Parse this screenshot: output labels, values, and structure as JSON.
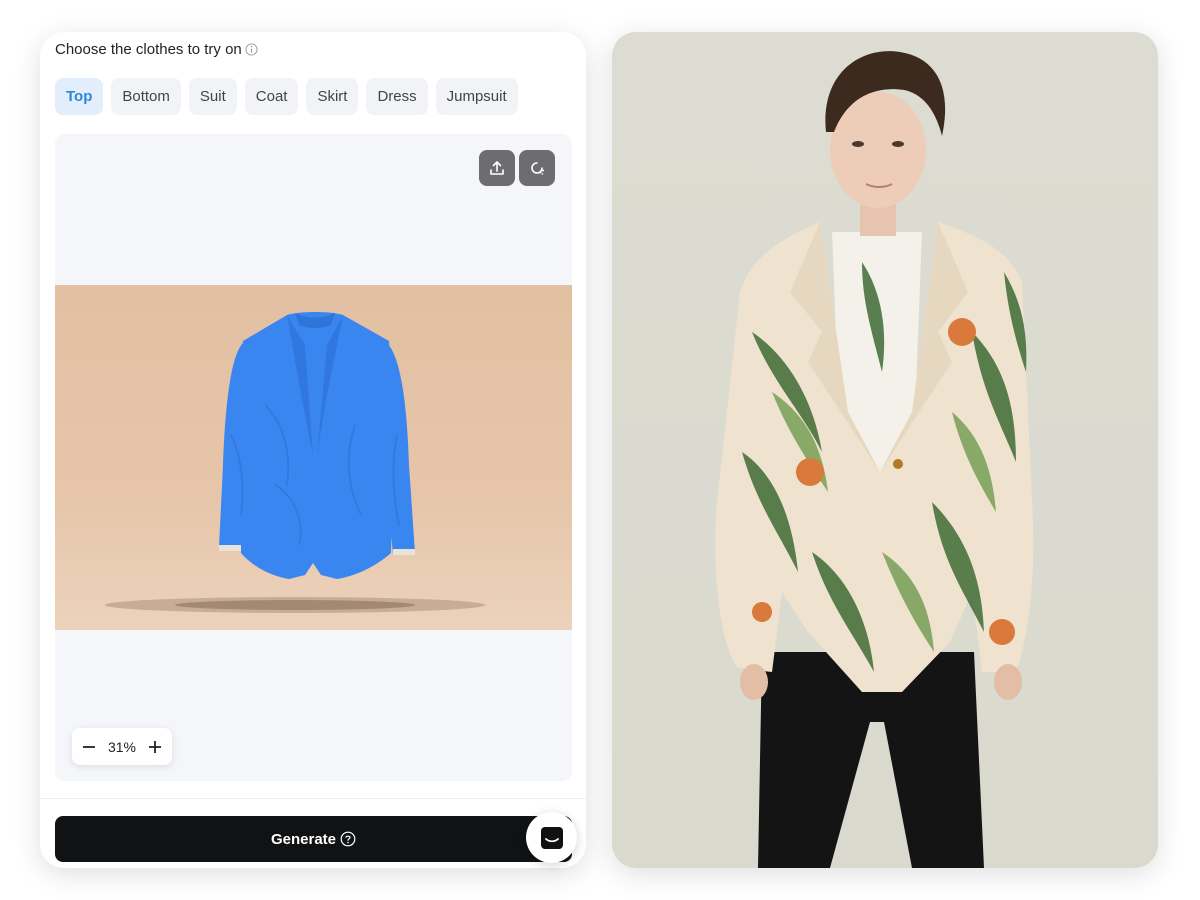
{
  "header": {
    "title": "Choose the clothes to try on",
    "info_icon": "info-icon"
  },
  "tabs": [
    {
      "label": "Top",
      "active": true
    },
    {
      "label": "Bottom",
      "active": false
    },
    {
      "label": "Suit",
      "active": false
    },
    {
      "label": "Coat",
      "active": false
    },
    {
      "label": "Skirt",
      "active": false
    },
    {
      "label": "Dress",
      "active": false
    },
    {
      "label": "Jumpsuit",
      "active": false
    }
  ],
  "canvas": {
    "tools": [
      "upload-icon",
      "replace-icon"
    ],
    "garment_highlight_color": "#3a86f0",
    "zoom": "31%"
  },
  "generate": {
    "label": "Generate",
    "help_icon": "help-icon"
  },
  "chat": {
    "icon": "chat-icon"
  },
  "colors": {
    "accent": "#2f87d6",
    "button_dark": "#111214"
  }
}
